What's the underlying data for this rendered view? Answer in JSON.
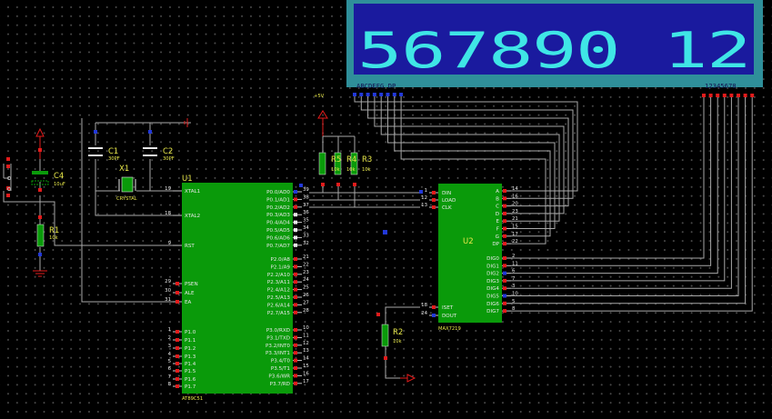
{
  "display": {
    "digits": "567890 12",
    "segments_label": "ABCDEFG DP",
    "digits_label": "12345678"
  },
  "power": {
    "vcc_label": "+5V"
  },
  "components": {
    "c1": {
      "ref": "C1",
      "value": "30PF"
    },
    "c2": {
      "ref": "C2",
      "value": "30PF"
    },
    "c4": {
      "ref": "C4",
      "value": "10uF"
    },
    "x1": {
      "ref": "X1",
      "value": "CRYSTAL"
    },
    "r1": {
      "ref": "R1",
      "value": "10k"
    },
    "r2": {
      "ref": "R2",
      "value": "10k"
    },
    "r3": {
      "ref": "R3",
      "value": "10k"
    },
    "r4": {
      "ref": "R4",
      "value": "10k"
    },
    "r5": {
      "ref": "R5",
      "value": "10k"
    }
  },
  "u1": {
    "ref": "U1",
    "part": "AT89C51",
    "left_pins": [
      {
        "num": "19",
        "name": "XTAL1"
      },
      {
        "num": "18",
        "name": "XTAL2"
      },
      {
        "num": "9",
        "name": "RST"
      },
      {
        "num": "29",
        "name": "PSEN"
      },
      {
        "num": "30",
        "name": "ALE"
      },
      {
        "num": "31",
        "name": "EA"
      },
      {
        "num": "1",
        "name": "P1.0"
      },
      {
        "num": "2",
        "name": "P1.1"
      },
      {
        "num": "3",
        "name": "P1.2"
      },
      {
        "num": "4",
        "name": "P1.3"
      },
      {
        "num": "5",
        "name": "P1.4"
      },
      {
        "num": "6",
        "name": "P1.5"
      },
      {
        "num": "7",
        "name": "P1.6"
      },
      {
        "num": "8",
        "name": "P1.7"
      }
    ],
    "right_pins": [
      {
        "num": "39",
        "name": "P0.0/AD0"
      },
      {
        "num": "38",
        "name": "P0.1/AD1"
      },
      {
        "num": "37",
        "name": "P0.2/AD2"
      },
      {
        "num": "36",
        "name": "P0.3/AD3"
      },
      {
        "num": "35",
        "name": "P0.4/AD4"
      },
      {
        "num": "34",
        "name": "P0.5/AD5"
      },
      {
        "num": "33",
        "name": "P0.6/AD6"
      },
      {
        "num": "32",
        "name": "P0.7/AD7"
      },
      {
        "num": "21",
        "name": "P2.0/A8"
      },
      {
        "num": "22",
        "name": "P2.1/A9"
      },
      {
        "num": "23",
        "name": "P2.2/A10"
      },
      {
        "num": "24",
        "name": "P2.3/A11"
      },
      {
        "num": "25",
        "name": "P2.4/A12"
      },
      {
        "num": "26",
        "name": "P2.5/A13"
      },
      {
        "num": "27",
        "name": "P2.6/A14"
      },
      {
        "num": "28",
        "name": "P2.7/A15"
      },
      {
        "num": "10",
        "name": "P3.0/RXD"
      },
      {
        "num": "11",
        "name": "P3.1/TXD"
      },
      {
        "num": "12",
        "name": "P3.2/INT0"
      },
      {
        "num": "13",
        "name": "P3.3/INT1"
      },
      {
        "num": "14",
        "name": "P3.4/T0"
      },
      {
        "num": "15",
        "name": "P3.5/T1"
      },
      {
        "num": "16",
        "name": "P3.6/WR"
      },
      {
        "num": "17",
        "name": "P3.7/RD"
      }
    ]
  },
  "u2": {
    "ref": "U2",
    "part": "MAX7219",
    "left_pins": [
      {
        "num": "1",
        "name": "DIN"
      },
      {
        "num": "12",
        "name": "LOAD"
      },
      {
        "num": "13",
        "name": "CLK"
      },
      {
        "num": "18",
        "name": "ISET"
      },
      {
        "num": "24",
        "name": "DOUT"
      }
    ],
    "right_pins": [
      {
        "num": "14",
        "name": "A"
      },
      {
        "num": "16",
        "name": "B"
      },
      {
        "num": "20",
        "name": "C"
      },
      {
        "num": "23",
        "name": "D"
      },
      {
        "num": "21",
        "name": "E"
      },
      {
        "num": "15",
        "name": "F"
      },
      {
        "num": "17",
        "name": "G"
      },
      {
        "num": "22",
        "name": "DP"
      },
      {
        "num": "2",
        "name": "DIG0"
      },
      {
        "num": "11",
        "name": "DIG1"
      },
      {
        "num": "6",
        "name": "DIG2"
      },
      {
        "num": "7",
        "name": "DIG3"
      },
      {
        "num": "3",
        "name": "DIG4"
      },
      {
        "num": "10",
        "name": "DIG5"
      },
      {
        "num": "5",
        "name": "DIG6"
      },
      {
        "num": "8",
        "name": "DIG7"
      }
    ]
  },
  "colors": {
    "chip": "#0a9a0a",
    "display_frame": "#2f8f9a",
    "display_panel": "#1a1a9e",
    "digits": "#3fe6e6",
    "pin_high": "#e21b1b",
    "pin_low": "#2238d8",
    "text_ref": "#e8e84a"
  }
}
